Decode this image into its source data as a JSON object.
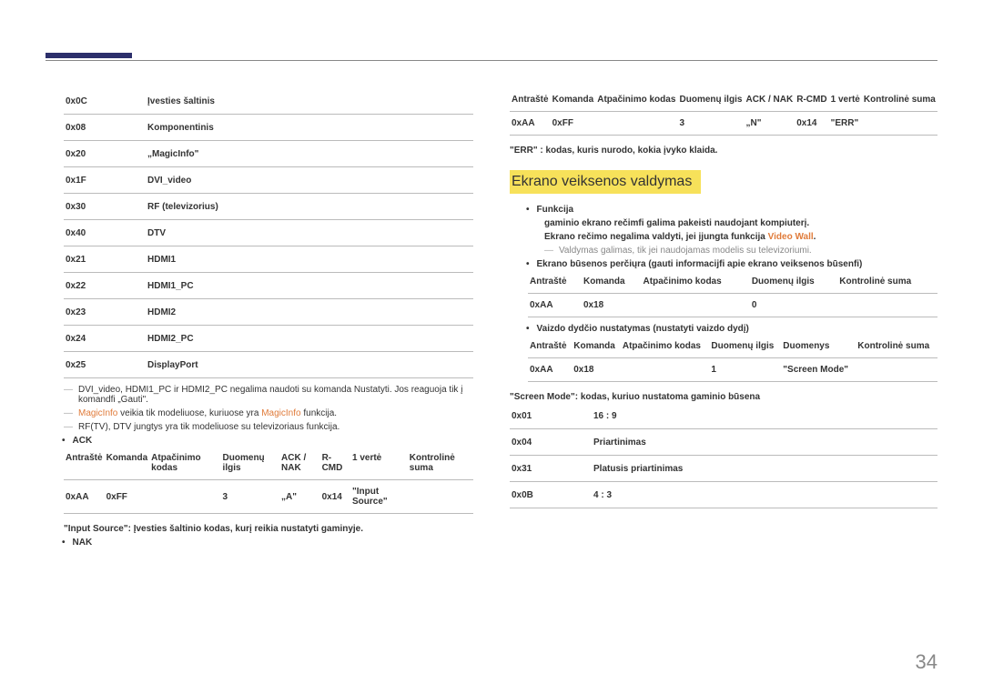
{
  "left": {
    "codes": [
      {
        "code": "0x0C",
        "desc": "Įvesties šaltinis"
      },
      {
        "code": "0x08",
        "desc": "Komponentinis"
      },
      {
        "code": "0x20",
        "desc": "„MagicInfo\""
      },
      {
        "code": "0x1F",
        "desc": "DVI_video"
      },
      {
        "code": "0x30",
        "desc": "RF (televizorius)"
      },
      {
        "code": "0x40",
        "desc": "DTV"
      },
      {
        "code": "0x21",
        "desc": "HDMI1"
      },
      {
        "code": "0x22",
        "desc": "HDMI1_PC"
      },
      {
        "code": "0x23",
        "desc": "HDMI2"
      },
      {
        "code": "0x24",
        "desc": "HDMI2_PC"
      },
      {
        "code": "0x25",
        "desc": "DisplayPort"
      }
    ],
    "note1_pre": "DVI_video, HDMI1_PC ir HDMI2_PC negalima naudoti su komanda Nustatyti. Jos reaguoja tik į komandfi „Gauti\".",
    "note2_a": "MagicInfo",
    "note2_b": " veikia tik modeliuose, kuriuose yra ",
    "note2_c": "MagicInfo",
    "note2_d": " funkcija.",
    "note3": "RF(TV), DTV jungtys yra tik modeliuose su televizoriaus funkcija.",
    "ack": "ACK",
    "tbl_hdr": [
      "Antraštė",
      "Komanda",
      "Atpačinimo kodas",
      "Duomenų ilgis",
      "ACK / NAK",
      "R-CMD",
      "1 vertė",
      "Kontrolinė suma"
    ],
    "tbl_row": [
      "0xAA",
      "0xFF",
      "",
      "3",
      "„A\"",
      "0x14",
      "\"Input Source\"",
      ""
    ],
    "inputSourceNote": "\"Input Source\": Įvesties šaltinio kodas, kurį reikia nustatyti gaminyje.",
    "nak": "NAK"
  },
  "right": {
    "tbl1_hdr": [
      "Antraštė",
      "Komanda",
      "Atpačinimo kodas",
      "Duomenų ilgis",
      "ACK / NAK",
      "R-CMD",
      "1 vertė",
      "Kontrolinė suma"
    ],
    "tbl1_row": [
      "0xAA",
      "0xFF",
      "",
      "3",
      "„N\"",
      "0x14",
      "\"ERR\"",
      ""
    ],
    "errNote": "\"ERR\" : kodas, kuris nurodo, kokia įvyko klaida.",
    "heading": "Ekrano veiksenos valdymas",
    "funkcija": "Funkcija",
    "funcLine1": "gaminio ekrano rečimfi galima pakeisti naudojant kompiuterį.",
    "funcLine2a": "Ekrano rečimo negalima valdyti, jei įjungta funkcija ",
    "funcLine2b": "Video Wall",
    "funcLine2c": ".",
    "funcDash": "Valdymas galimas, tik jei naudojamas modelis su televizoriumi.",
    "bullet2": "Ekrano būsenos perčiųra (gauti informacijfi apie ekrano veiksenos būsenfi)",
    "tbl2_hdr": [
      "Antraštė",
      "Komanda",
      "Atpačinimo kodas",
      "Duomenų ilgis",
      "Kontrolinė suma"
    ],
    "tbl2_row": [
      "0xAA",
      "0x18",
      "",
      "0",
      ""
    ],
    "bullet3": "Vaizdo dydčio nustatymas (nustatyti vaizdo dydį)",
    "tbl3_hdr": [
      "Antraštė",
      "Komanda",
      "Atpačinimo kodas",
      "Duomenų ilgis",
      "Duomenys",
      "Kontrolinė suma"
    ],
    "tbl3_row": [
      "0xAA",
      "0x18",
      "",
      "1",
      "\"Screen Mode\"",
      ""
    ],
    "screenModeNote": "\"Screen Mode\": kodas, kuriuo nustatoma gaminio būsena",
    "modes": [
      {
        "code": "0x01",
        "desc": "16 : 9"
      },
      {
        "code": "0x04",
        "desc": "Priartinimas"
      },
      {
        "code": "0x31",
        "desc": "Platusis priartinimas"
      },
      {
        "code": "0x0B",
        "desc": "4 : 3"
      }
    ]
  },
  "pageNum": "34"
}
